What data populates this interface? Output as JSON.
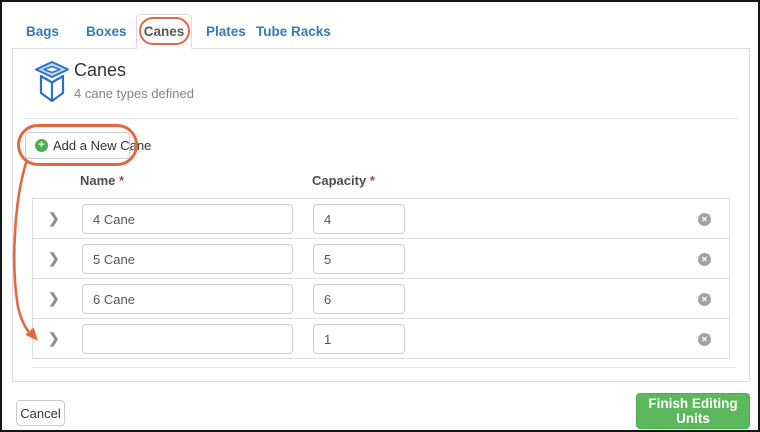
{
  "tabs": {
    "items": [
      {
        "label": "Bags"
      },
      {
        "label": "Boxes"
      },
      {
        "label": "Canes"
      },
      {
        "label": "Plates"
      },
      {
        "label": "Tube Racks"
      }
    ],
    "active": "Canes"
  },
  "panel": {
    "title": "Canes",
    "subtitle": "4 cane types defined"
  },
  "toolbar": {
    "add_button_label": "Add a New Cane"
  },
  "table": {
    "columns": [
      {
        "label": "Name",
        "required_mark": "*"
      },
      {
        "label": "Capacity",
        "required_mark": "*"
      }
    ],
    "rows": [
      {
        "name": "4 Cane",
        "capacity": "4"
      },
      {
        "name": "5 Cane",
        "capacity": "5"
      },
      {
        "name": "6 Cane",
        "capacity": "6"
      },
      {
        "name": "",
        "capacity": "1"
      }
    ]
  },
  "footer": {
    "cancel_label": "Cancel",
    "finish_label": "Finish Editing Units"
  },
  "icons": {
    "plus": "+",
    "chevron": "❯",
    "close": "✕"
  },
  "colors": {
    "annotation_orange": "#e2693f",
    "link_blue": "#337ab7",
    "success_green": "#5cb85c",
    "icon_blue": "#2a72c8"
  }
}
